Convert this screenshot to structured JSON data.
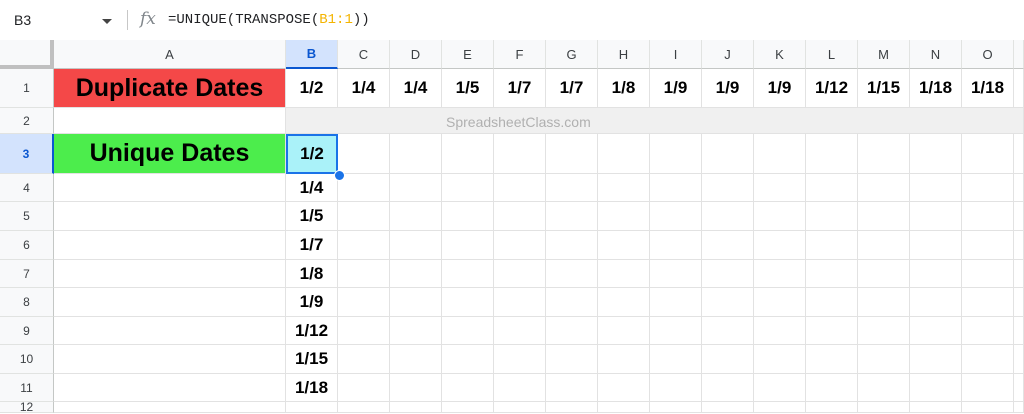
{
  "formula_bar": {
    "name_box": "B3",
    "fx_icon": "fx",
    "formula_prefix": "=UNIQUE(TRANSPOSE(",
    "formula_ref": "B1:1",
    "formula_suffix": "))"
  },
  "columns": [
    "A",
    "B",
    "C",
    "D",
    "E",
    "F",
    "G",
    "H",
    "I",
    "J",
    "K",
    "L",
    "M",
    "N",
    "O"
  ],
  "selected_column": "B",
  "rows": [
    "1",
    "2",
    "3",
    "4",
    "5",
    "6",
    "7",
    "8",
    "9",
    "10",
    "11",
    "12"
  ],
  "selected_row": "3",
  "cells": {
    "A1": "Duplicate Dates",
    "A3": "Unique Dates",
    "row1_dates": [
      "1/2",
      "1/4",
      "1/4",
      "1/5",
      "1/7",
      "1/7",
      "1/8",
      "1/9",
      "1/9",
      "1/9",
      "1/12",
      "1/15",
      "1/18",
      "1/18"
    ],
    "colB_unique": [
      "1/2",
      "1/4",
      "1/5",
      "1/7",
      "1/8",
      "1/9",
      "1/12",
      "1/15",
      "1/18"
    ]
  },
  "watermark": "SpreadsheetClass.com",
  "colors": {
    "duplicate_fill": "#f44848",
    "unique_fill": "#4ced4c",
    "active_cell_fill": "#aaf2f9",
    "selection_blue": "#1a73e8"
  }
}
